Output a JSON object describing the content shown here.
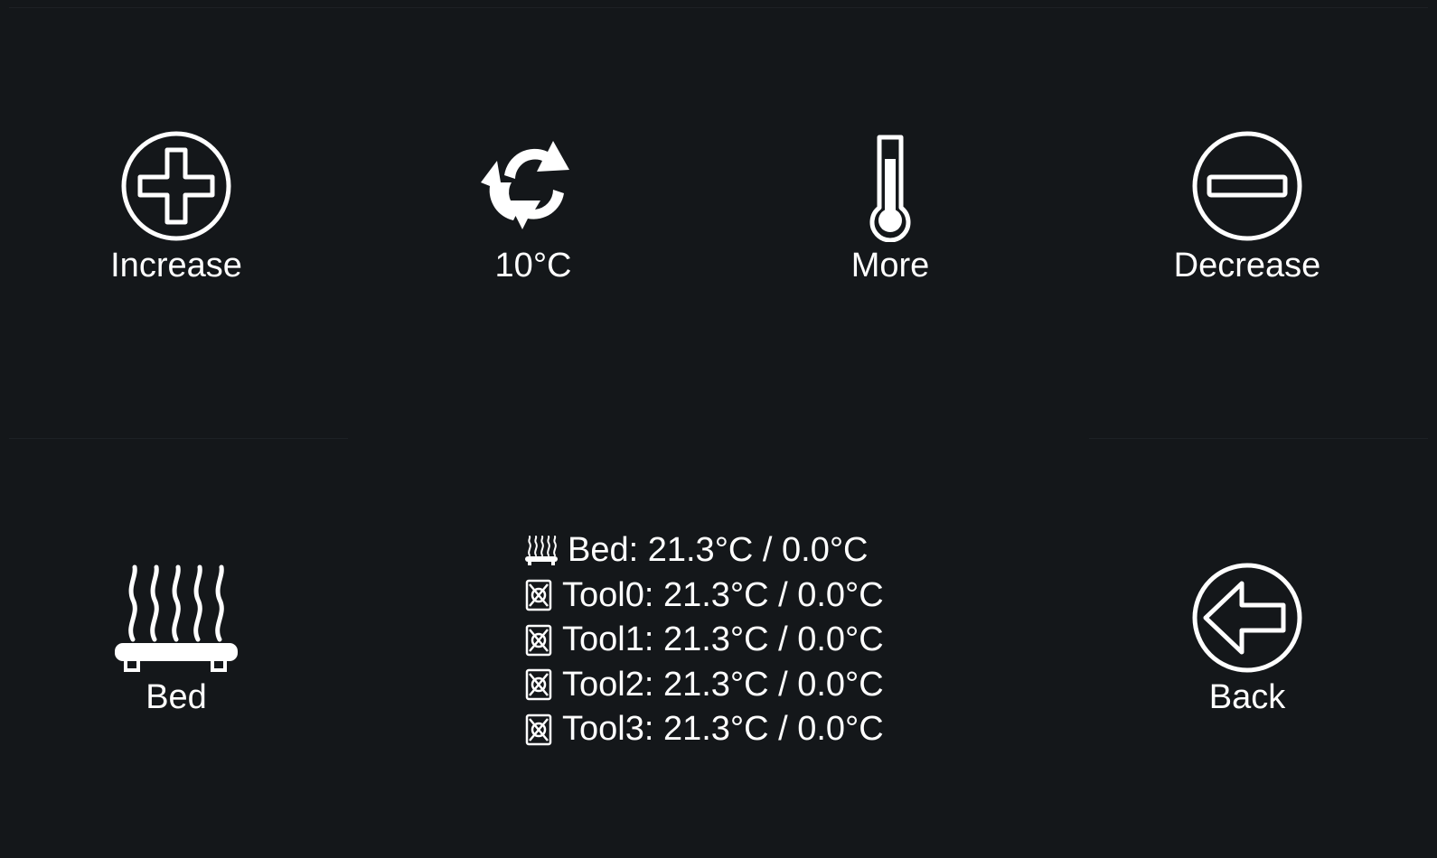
{
  "buttons": {
    "increase": {
      "label": "Increase",
      "icon": "plus-circle-icon"
    },
    "step": {
      "label": "10°C",
      "icon": "cycle-arrows-icon"
    },
    "more": {
      "label": "More",
      "icon": "thermometer-icon"
    },
    "decrease": {
      "label": "Decrease",
      "icon": "minus-circle-icon"
    },
    "bed": {
      "label": "Bed",
      "icon": "heated-bed-icon"
    },
    "back": {
      "label": "Back",
      "icon": "back-arrow-icon"
    }
  },
  "status": {
    "lines": [
      {
        "text": "Bed: 21.3°C / 0.0°C",
        "icon": "heated-bed-icon"
      },
      {
        "text": "Tool0: 21.3°C / 0.0°C",
        "icon": "nozzle-icon"
      },
      {
        "text": "Tool1: 21.3°C / 0.0°C",
        "icon": "nozzle-icon"
      },
      {
        "text": "Tool2: 21.3°C / 0.0°C",
        "icon": "nozzle-icon"
      },
      {
        "text": "Tool3: 21.3°C / 0.0°C",
        "icon": "nozzle-icon"
      }
    ]
  },
  "colors": {
    "background": "#14171a",
    "foreground": "#ffffff"
  }
}
